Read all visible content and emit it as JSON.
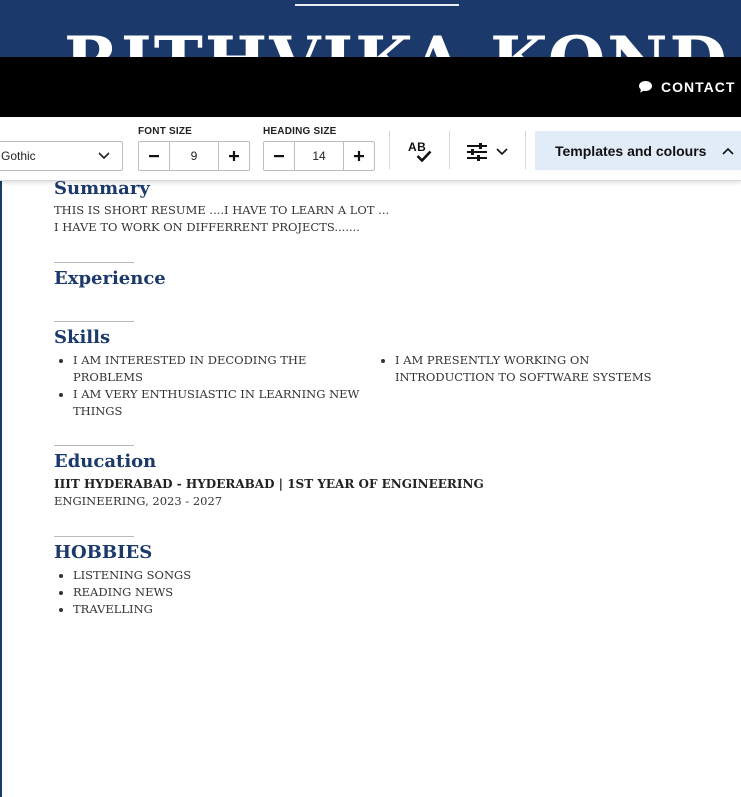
{
  "resume": {
    "name": "RITHVIKA KONDA",
    "summary": {
      "heading": "Summary",
      "lines": [
        "THIS IS SHORT RESUME ....I HAVE TO LEARN A LOT ...",
        "I HAVE TO WORK ON DIFFERRENT PROJECTS......."
      ]
    },
    "experience": {
      "heading": "Experience"
    },
    "skills": {
      "heading": "Skills",
      "left": [
        "I AM INTERESTED IN DECODING THE PROBLEMS",
        "I AM VERY ENTHUSIASTIC IN LEARNING NEW THINGS"
      ],
      "right": [
        "I AM PRESENTLY WORKING ON INTRODUCTION TO SOFTWARE SYSTEMS"
      ]
    },
    "education": {
      "heading": "Education",
      "title": "IIIT HYDERABAD - HYDERABAD | 1ST YEAR OF ENGINEERING",
      "detail": "ENGINEERING, 2023 - 2027"
    },
    "hobbies": {
      "heading": "HOBBIES",
      "items": [
        "LISTENING SONGS",
        "READING NEWS",
        "TRAVELLING"
      ]
    }
  },
  "nav": {
    "contact_label": "CONTACT US",
    "icon": "speech-bubble-icon"
  },
  "toolbar": {
    "font_family_value": "Gothic",
    "font_size_label": "FONT SIZE",
    "font_size_value": "9",
    "heading_size_label": "HEADING SIZE",
    "heading_size_value": "14",
    "spellcheck_label": "AB",
    "templates_label": "Templates and colours"
  },
  "colors": {
    "brand_navy": "#1b3a6b",
    "nav_black": "#000000",
    "templates_bg": "#e2ecf8",
    "text_gray": "#333333"
  }
}
